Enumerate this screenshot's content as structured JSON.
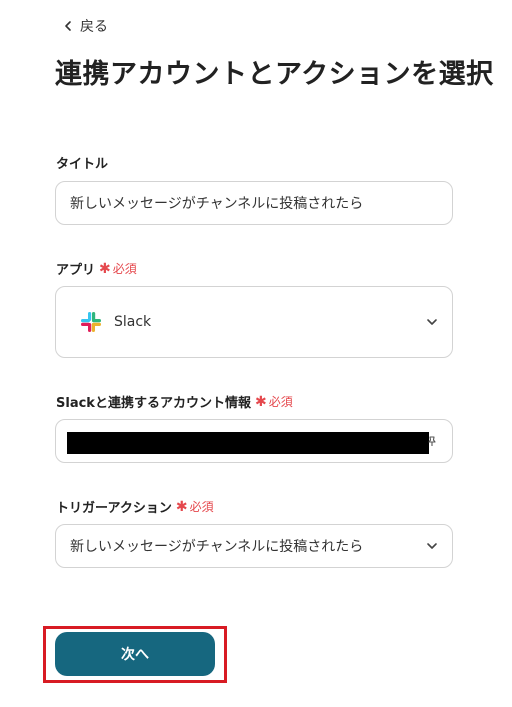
{
  "header": {
    "back_label": "戻る",
    "page_title": "連携アカウントとアクションを選択"
  },
  "form": {
    "title_field": {
      "label": "タイトル",
      "value": "新しいメッセージがチャンネルに投稿されたら"
    },
    "app_field": {
      "label": "アプリ",
      "required_label": "必須",
      "value": "Slack",
      "icon": "slack-logo"
    },
    "account_field": {
      "label": "Slackと連携するアカウント情報",
      "required_label": "必須",
      "value_redacted": true
    },
    "trigger_field": {
      "label": "トリガーアクション",
      "required_label": "必須",
      "value": "新しいメッセージがチャンネルに投稿されたら"
    }
  },
  "footer": {
    "next_label": "次へ"
  },
  "colors": {
    "primary_button": "#16677f",
    "required": "#e5484d",
    "highlight_border": "#d81b23"
  }
}
